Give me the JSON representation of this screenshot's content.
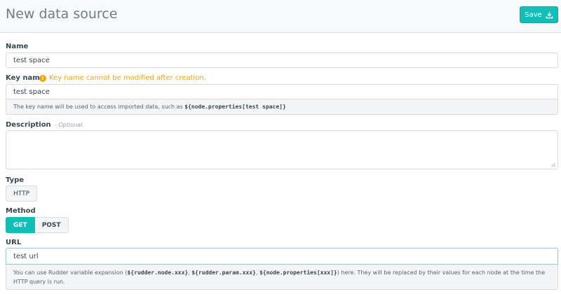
{
  "header": {
    "title": "New data source",
    "save_label": "Save"
  },
  "name_field": {
    "label": "Name",
    "value": "test space"
  },
  "key_field": {
    "label": "Key name",
    "warning": "Key name cannot be modified after creation.",
    "value": "test space",
    "help_prefix": "The key name will be used to access imported data, such as ",
    "help_code": "${node.properties[test space]}"
  },
  "description_field": {
    "label": "Description",
    "optional": "- Optional",
    "value": ""
  },
  "type_field": {
    "label": "Type",
    "options": [
      "HTTP"
    ]
  },
  "method_field": {
    "label": "Method",
    "options": [
      "GET",
      "POST"
    ],
    "selected": "GET"
  },
  "url_field": {
    "label": "URL",
    "value": "test url",
    "help_prefix": "You can use Rudder variable expansion (",
    "help_code_1": "${rudder.node.xxx}",
    "help_sep_1": ", ",
    "help_code_2": "${rudder.param.xxx}",
    "help_sep_2": ", ",
    "help_code_3": "${node.properties[xxx]}",
    "help_suffix": ") here. They will be replaced by their values for each node at the time the HTTP query is run."
  },
  "colors": {
    "accent": "#13beb7",
    "warning": "#e8a31b"
  }
}
